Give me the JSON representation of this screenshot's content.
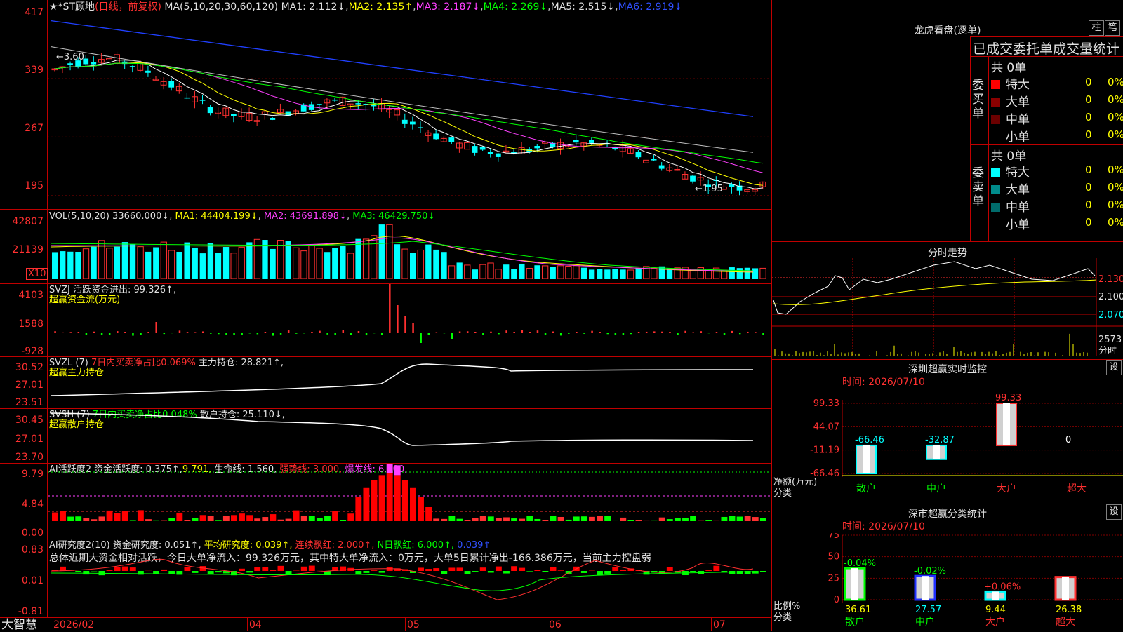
{
  "header": {
    "stock": "★*ST顾地",
    "period": "(日线，前复权)",
    "ma_label": "MA(5,10,20,30,60,120)",
    "ma1": "MA1: 2.112↓",
    "ma2": "MA2: 2.135↑",
    "ma3": "MA3: 2.187↓",
    "ma4": "MA4: 2.269↓",
    "ma5": "MA5: 2.515↓",
    "ma6": "MA6: 2.919↓"
  },
  "price_axis": [
    "417",
    "339",
    "267",
    "195"
  ],
  "annotations": {
    "high": "3.60",
    "low": "1.95"
  },
  "vol": {
    "label": "VOL(5,10,20)",
    "value": "33660.000↓",
    "ma1": "MA1: 44404.199↓",
    "ma2": "MA2: 43691.898↓",
    "ma3": "MA3: 46429.750↓",
    "axis": [
      "42807",
      "21139"
    ],
    "unit": "X10"
  },
  "svzj": {
    "line1": "SVZJ  活跃资金进出: 99.326↑,",
    "line2": "超赢资金流(万元)",
    "axis": [
      "4103",
      "1588",
      "-928"
    ]
  },
  "svzl": {
    "label": "SVZL (7)",
    "mid": "7日内买卖净占比0.069%",
    "right": "主力持仓: 28.821↑,",
    "line2": "超赢主力持仓",
    "axis": [
      "30.52",
      "27.01",
      "23.51"
    ]
  },
  "svsh": {
    "label": "SVSH (7)",
    "mid": "7日内买卖净占比0.048%",
    "right": "散户持仓: 25.110↓,",
    "line2": "超赢散户持仓",
    "axis": [
      "30.45",
      "27.01",
      "23.70"
    ]
  },
  "ai1": {
    "label": "AI活跃度2",
    "a": "资金活跃度: 0.375↑,",
    "b": "9.791,",
    "c": "生命线: 1.560,",
    "d": "强势线: 3.000,",
    "e": "爆发线: 6.000,",
    "axis": [
      "9.79",
      "4.84",
      "0.00"
    ]
  },
  "ai2": {
    "label": "AI研究度2(10)",
    "a": "资金研究度: 0.051↑,",
    "b": "平均研究度: 0.039↑,",
    "c": "连续飘红: 2.000↑,",
    "d": "N日飘红: 6.000↑,",
    "e": "0.039↑",
    "summary": "总体近期大资金相对活跃，今日大单净流入：99.326万元，其中特大单净流入：0万元，大单5日累计净出-166.386万元，当前主力控盘弱",
    "axis": [
      "0.83",
      "0.01",
      "-0.81"
    ]
  },
  "dates": [
    "2026/02",
    "04",
    "05",
    "06",
    "07"
  ],
  "brand": "大智慧",
  "right_panel": {
    "lhb_title": "龙虎看盘(逐单)",
    "btn1": "柱",
    "btn2": "笔",
    "stats_title": "已成交委托单成交量统计",
    "buy_total": "共 0单",
    "sell_total": "共 0单",
    "buy_side": "委买单",
    "sell_side": "委卖单",
    "buy_rows": [
      {
        "name": "特大",
        "n": "0",
        "p": "0%"
      },
      {
        "name": "大单",
        "n": "0",
        "p": "0%"
      },
      {
        "name": "中单",
        "n": "0",
        "p": "0%"
      },
      {
        "name": "小单",
        "n": "0",
        "p": "0%"
      }
    ],
    "sell_rows": [
      {
        "name": "特大",
        "n": "0",
        "p": "0%"
      },
      {
        "name": "大单",
        "n": "0",
        "p": "0%"
      },
      {
        "name": "中单",
        "n": "0",
        "p": "0%"
      },
      {
        "name": "小单",
        "n": "0",
        "p": "0%"
      }
    ],
    "fenshi_title": "分时走势",
    "fenshi_axis": [
      "2.130",
      "2.100",
      "2.070"
    ],
    "fenshi_vol": "2573",
    "fenshi_unit": "分时",
    "monitor_title": "深圳超赢实时监控",
    "monitor_time": "时间: 2026/07/10",
    "monitor_axis": [
      "99.33",
      "44.07",
      "-11.19",
      "-66.46"
    ],
    "monitor_ylabel": "净额(万元)",
    "monitor_xlabel": "分类",
    "monitor_cats": [
      "散户",
      "中户",
      "大户",
      "超大"
    ],
    "monitor_vals": [
      "-66.46",
      "-32.87",
      "99.33",
      "0"
    ],
    "stat_title": "深市超赢分类统计",
    "stat_time": "时间: 2026/07/10",
    "stat_axis": [
      "75",
      "50",
      "25",
      "0"
    ],
    "stat_ylabel": "比例%",
    "stat_xlabel": "分类",
    "stat_cats": [
      "散户",
      "中户",
      "大户",
      "超大"
    ],
    "stat_bottom": [
      "36.61",
      "27.57",
      "9.44",
      "26.38"
    ],
    "stat_top": [
      "-0.04%",
      "-0.02%",
      "+0.06%",
      ""
    ],
    "set": "设"
  },
  "chart_data": [
    {
      "type": "bar",
      "title": "深圳超赢实时监控",
      "categories": [
        "散户",
        "中户",
        "大户",
        "超大"
      ],
      "values": [
        -66.46,
        -32.87,
        99.33,
        0
      ],
      "ylabel": "净额(万元)",
      "xlabel": "分类",
      "ylim": [
        -66.46,
        99.33
      ]
    },
    {
      "type": "bar",
      "title": "深市超赢分类统计",
      "categories": [
        "散户",
        "中户",
        "大户",
        "超大"
      ],
      "values": [
        36.61,
        27.57,
        9.44,
        26.38
      ],
      "ylabel": "比例%",
      "xlabel": "分类",
      "ylim": [
        0,
        75
      ]
    }
  ]
}
